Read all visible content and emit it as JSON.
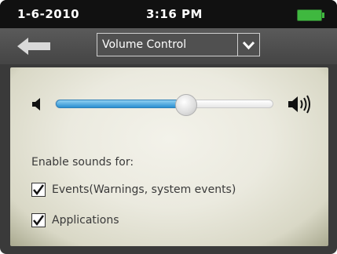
{
  "status_bar": {
    "date": "1-6-2010",
    "time": "3:16 PM",
    "battery_icon": "battery-icon",
    "battery_color": "#3fb83f"
  },
  "header": {
    "back_icon": "back-arrow-icon",
    "dropdown": {
      "selected": "Volume Control",
      "arrow_icon": "chevron-down-icon"
    }
  },
  "volume": {
    "low_icon": "speaker-low-icon",
    "high_icon": "speaker-high-icon",
    "level": 0.6,
    "accent_color": "#2a8fd0"
  },
  "sounds": {
    "heading": "Enable sounds for:",
    "options": [
      {
        "label": "Events(Warnings, system events)",
        "checked": true
      },
      {
        "label": "Applications",
        "checked": true
      }
    ]
  }
}
